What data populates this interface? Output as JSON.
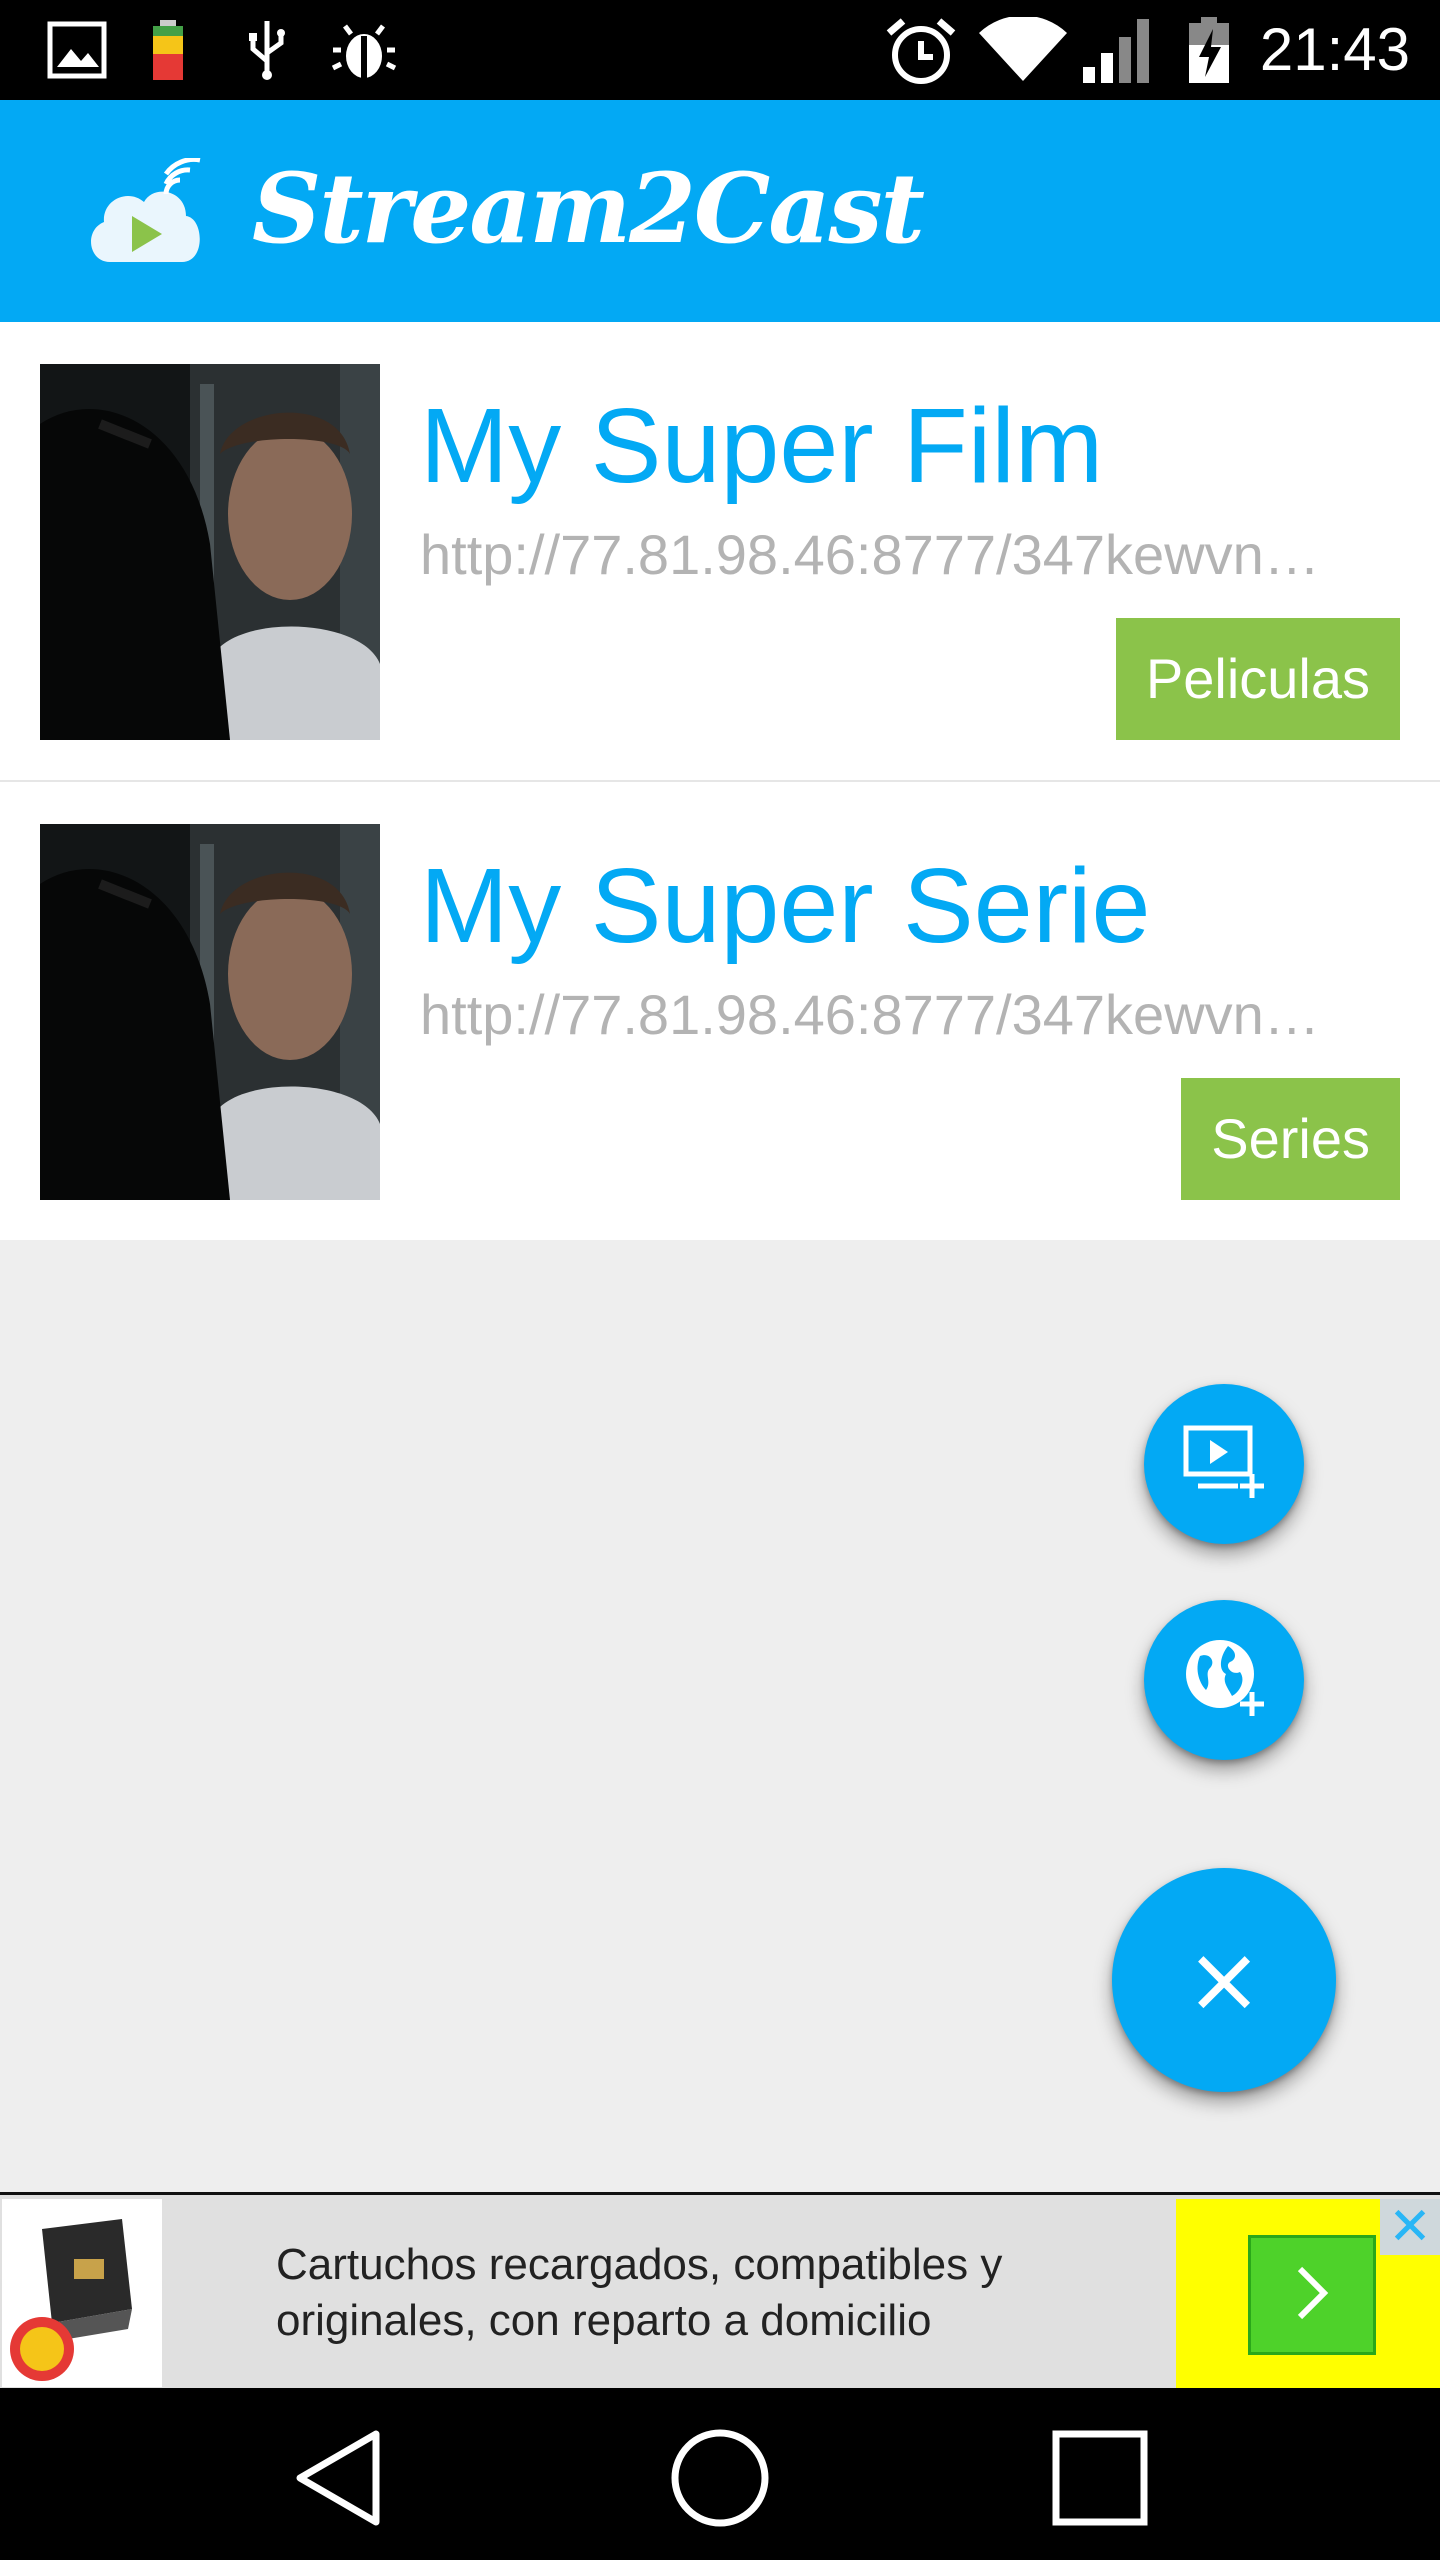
{
  "status_bar": {
    "time": "21:43",
    "left_icons": [
      "image-icon",
      "battery-saver-icon",
      "usb-icon",
      "debug-icon"
    ],
    "right_icons": [
      "alarm-icon",
      "wifi-icon",
      "signal-icon",
      "battery-charging-icon"
    ]
  },
  "app_bar": {
    "title": "Stream2Cast",
    "logo_icon": "cloud-play-icon",
    "color": "#03a9f4"
  },
  "list": {
    "items": [
      {
        "title": "My Super Film",
        "url": "http://77.81.98.46:8777/347kewvn…",
        "tag": "Peliculas"
      },
      {
        "title": "My Super Serie",
        "url": "http://77.81.98.46:8777/347kewvn…",
        "tag": "Series"
      }
    ]
  },
  "fabs": {
    "add_video_icon": "add-video-icon",
    "add_web_icon": "add-globe-icon",
    "close_label": "×"
  },
  "ad": {
    "text": "Cartuchos recargados, compatibles y originales, con reparto a domicilio",
    "cta_icon": "chevron-right-icon",
    "close_label": "✕"
  },
  "nav_bar": {
    "buttons": [
      "back-icon",
      "home-icon",
      "recents-icon"
    ]
  },
  "colors": {
    "accent": "#03a9f4",
    "tag": "#8bc34a",
    "background": "#eeeeee"
  }
}
